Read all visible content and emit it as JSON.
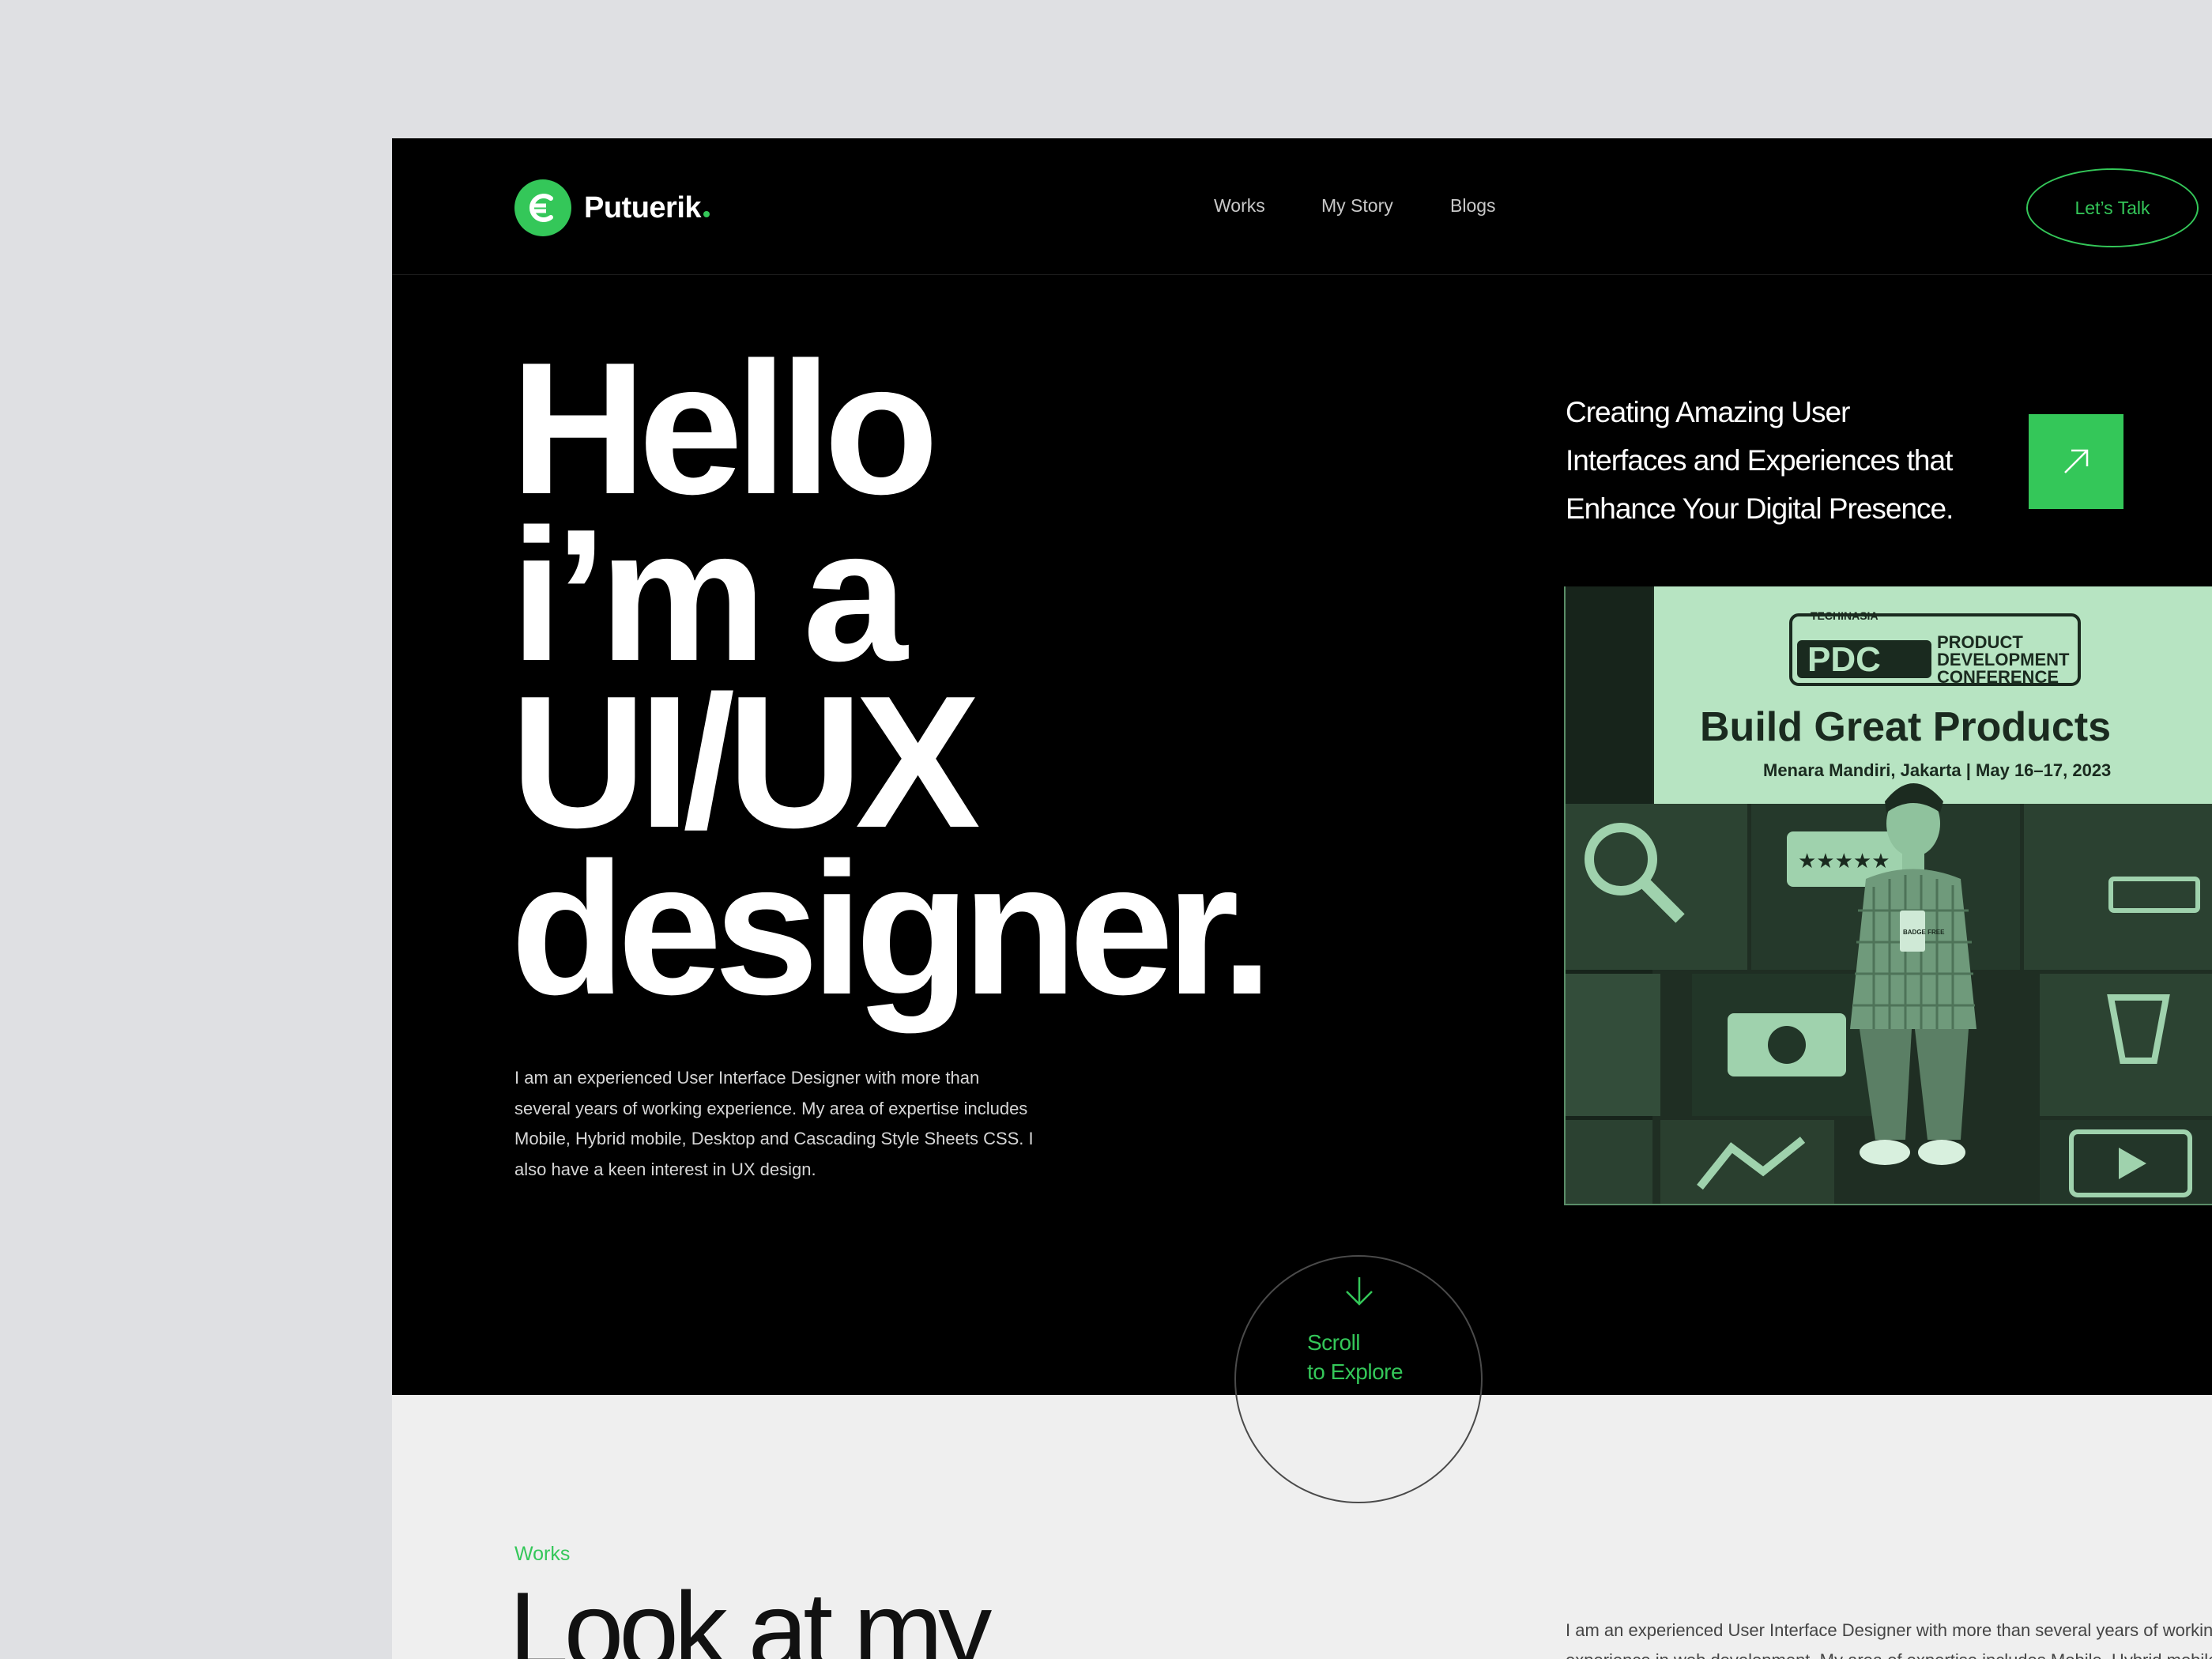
{
  "brand": {
    "name": "Putuerik",
    "logo_icon": "euro-c-icon",
    "accent_color": "#34c759"
  },
  "nav": {
    "links": [
      "Works",
      "My Story",
      "Blogs"
    ],
    "cta_label": "Let’s Talk"
  },
  "hero": {
    "headline_lines": [
      "Hello",
      "i’m a",
      "UI/UX",
      "designer."
    ],
    "intro": "I am an experienced User Interface Designer with more than several years of working experience. My area of expertise includes Mobile, Hybrid mobile, Desktop and Cascading Style Sheets CSS. I also have a keen interest in UX design.",
    "tagline_lines": [
      "Creating Amazing User",
      "Interfaces and Experiences that",
      "Enhance Your Digital Presence."
    ],
    "arrow_icon": "arrow-up-right-icon",
    "scroll_lines": [
      "Scroll",
      "to Explore"
    ],
    "scroll_icon": "arrow-down-icon"
  },
  "photo": {
    "banner_brand": "TECHINASIA",
    "banner_logo": "PDC",
    "banner_subtitle_lines": [
      "PRODUCT",
      "DEVELOPMENT",
      "CONFERENCE"
    ],
    "banner_title": "Build Great Products",
    "banner_location": "Menara Mandiri, Jakarta | May 16–17, 2023",
    "badge_text": "BADGE FREE"
  },
  "works": {
    "label": "Works",
    "heading": "Look at my",
    "description": "I am an experienced User Interface Designer with more than several years of working experience in web development. My area of expertise includes Mobile, Hybrid mobile"
  }
}
